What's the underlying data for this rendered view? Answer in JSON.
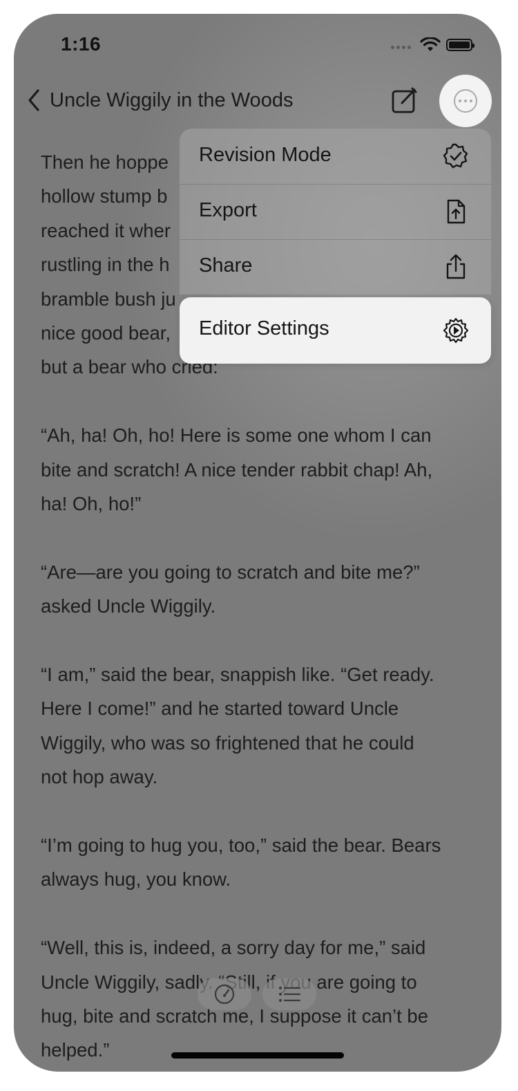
{
  "status_bar": {
    "time": "1:16",
    "icons": [
      "cellular-dots-icon",
      "wifi-icon",
      "battery-icon"
    ]
  },
  "nav": {
    "title": "Uncle Wiggily in the Woods",
    "back_icon": "chevron-left-icon",
    "compose_icon": "compose-icon",
    "more_icon": "ellipsis-circle-icon"
  },
  "body": {
    "paragraphs": [
      "Then he hopped along until he came to a hollow stump b... reached it when there was a rustling in the h... bramble bush ju... nice good bear, but a bear who cried:",
      "“Ah, ha! Oh, ho! Here is some one whom I can bite and scratch! A nice tender rabbit chap! Ah, ha! Oh, ho!”",
      "“Are—are you going to scratch and bite me?” asked Uncle Wiggily.",
      "“I am,” said the bear, snappish like. “Get ready. Here I come!” and he started toward Uncle Wiggily, who was so frightened that he could not hop away.",
      "“I’m going to hug you, too,” said the bear. Bears always hug, you know.",
      "“Well, this is, indeed, a sorry day for me,” said Uncle Wiggily, sadly. “Still, if you are going to hug, bite and scratch me, I suppose it can’t be helped.”"
    ],
    "visible_lines": {
      "p1": [
        "Then he hoppe",
        "hollow stump b",
        "reached it wher",
        "rustling in the h",
        "bramble bush ju",
        "nice good bear,",
        "but a bear who cried:"
      ],
      "p2": [
        "“Ah, ha! Oh, ho! Here is some one whom I can",
        "bite and scratch! A nice tender rabbit chap! Ah,",
        "ha! Oh, ho!”"
      ],
      "p3": [
        "“Are—are you going to scratch and bite me?”",
        "asked Uncle Wiggily."
      ],
      "p4": [
        "“I am,” said the bear, snappish like. “Get ready.",
        "Here I come!” and he started toward Uncle",
        "Wiggily, who was so frightened that he could",
        "not hop away."
      ],
      "p5": [
        "“I’m going to hug you, too,” said the bear. Bears",
        "always hug, you know."
      ],
      "p6": [
        "“Well, this is, indeed, a sorry day for me,” said",
        "Uncle Wiggily, sadly. “Still, if you are going to",
        "hug, bite and scratch me, I suppose it can’t be",
        "helped.”"
      ]
    }
  },
  "menu": {
    "items": [
      {
        "label": "Revision Mode",
        "icon": "checkmark-seal-icon"
      },
      {
        "label": "Export",
        "icon": "document-upload-icon"
      },
      {
        "label": "Share",
        "icon": "share-icon"
      },
      {
        "label": "Editor Settings",
        "icon": "gear-play-icon",
        "highlighted": true
      }
    ]
  },
  "toolbar": {
    "items": [
      {
        "icon": "speedometer-icon"
      },
      {
        "icon": "list-icon"
      }
    ]
  },
  "colors": {
    "dim_overlay": "#7b7b7b",
    "menu_highlight": "#f2f2f2",
    "text": "#1d1d1d"
  }
}
